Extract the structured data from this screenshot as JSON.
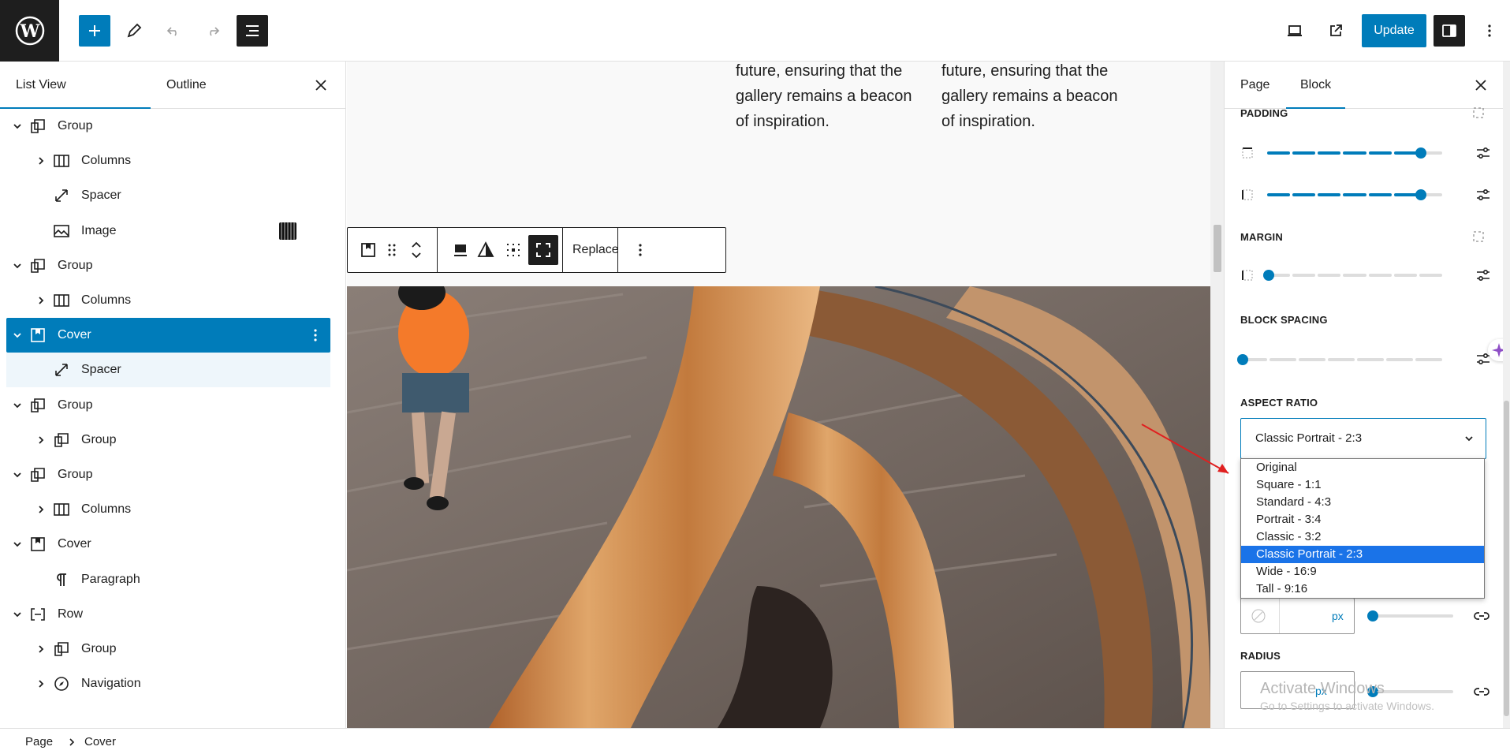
{
  "toolbar": {
    "wp_logo": "wordpress-logo",
    "update_label": "Update",
    "add_icon": "plus-icon",
    "edit_icon": "pencil-icon",
    "undo_icon": "undo-icon",
    "redo_icon": "redo-icon",
    "document_overview_icon": "list-view-icon",
    "preview_icon": "laptop-icon",
    "view_icon": "external-link-icon",
    "settings_icon": "sidebar-toggle-icon",
    "options_icon": "kebab-icon"
  },
  "left_panel": {
    "tabs": [
      "List View",
      "Outline"
    ],
    "active_tab": "List View",
    "items": [
      {
        "label": "Group",
        "icon": "group-icon",
        "level": 0,
        "expanded": true
      },
      {
        "label": "Columns",
        "icon": "columns-icon",
        "level": 1,
        "expanded": false
      },
      {
        "label": "Spacer",
        "icon": "spacer-icon",
        "level": 1
      },
      {
        "label": "Image",
        "icon": "image-icon",
        "level": 1
      },
      {
        "label": "Group",
        "icon": "group-icon",
        "level": 0,
        "expanded": true
      },
      {
        "label": "Columns",
        "icon": "columns-icon",
        "level": 1,
        "expanded": false
      },
      {
        "label": "Cover",
        "icon": "cover-icon",
        "level": 0,
        "expanded": true,
        "selected": true
      },
      {
        "label": "Spacer",
        "icon": "spacer-icon",
        "level": 1
      },
      {
        "label": "Group",
        "icon": "group-icon",
        "level": 0,
        "expanded": true
      },
      {
        "label": "Group",
        "icon": "group-icon",
        "level": 1,
        "expanded": false
      },
      {
        "label": "Group",
        "icon": "group-icon",
        "level": 0,
        "expanded": true
      },
      {
        "label": "Columns",
        "icon": "columns-icon",
        "level": 1,
        "expanded": false
      },
      {
        "label": "Cover",
        "icon": "cover-icon",
        "level": 0,
        "expanded": true
      },
      {
        "label": "Paragraph",
        "icon": "paragraph-icon",
        "level": 1
      },
      {
        "label": "Row",
        "icon": "row-icon",
        "level": 0,
        "expanded": true
      },
      {
        "label": "Group",
        "icon": "group-icon",
        "level": 1,
        "expanded": false
      },
      {
        "label": "Navigation",
        "icon": "navigation-icon",
        "level": 1,
        "expanded": false
      }
    ]
  },
  "canvas": {
    "col1_text": "future, ensuring that the gallery remains a beacon of inspiration.",
    "col2_text": "future, ensuring that the gallery remains a beacon of inspiration.",
    "block_toolbar": {
      "replace_label": "Replace"
    }
  },
  "right_panel": {
    "tabs": [
      "Page",
      "Block"
    ],
    "active_tab": "Block",
    "padding_label": "PADDING",
    "padding_top_value": 0.88,
    "padding_bottom_value": 0.88,
    "margin_label": "MARGIN",
    "margin_value": 0.0,
    "block_spacing_label": "BLOCK SPACING",
    "block_spacing_value": 0.0,
    "aspect_ratio_label": "ASPECT RATIO",
    "aspect_ratio_selected": "Classic Portrait - 2:3",
    "aspect_ratio_options": [
      "Original",
      "Square - 1:1",
      "Standard - 4:3",
      "Portrait - 3:4",
      "Classic - 3:2",
      "Classic Portrait - 2:3",
      "Wide - 16:9",
      "Tall - 9:16"
    ],
    "unit_px": "px",
    "radius_label": "RADIUS",
    "radius_unit": "px",
    "watermark_line1": "Activate Windows",
    "watermark_line2": "Go to Settings to activate Windows."
  },
  "breadcrumb": {
    "items": [
      "Page",
      "Cover"
    ]
  },
  "colors": {
    "accent": "#007cba",
    "dark": "#1e1e1e",
    "option_highlight": "#1a73e8",
    "annotation_arrow": "#e02020"
  }
}
